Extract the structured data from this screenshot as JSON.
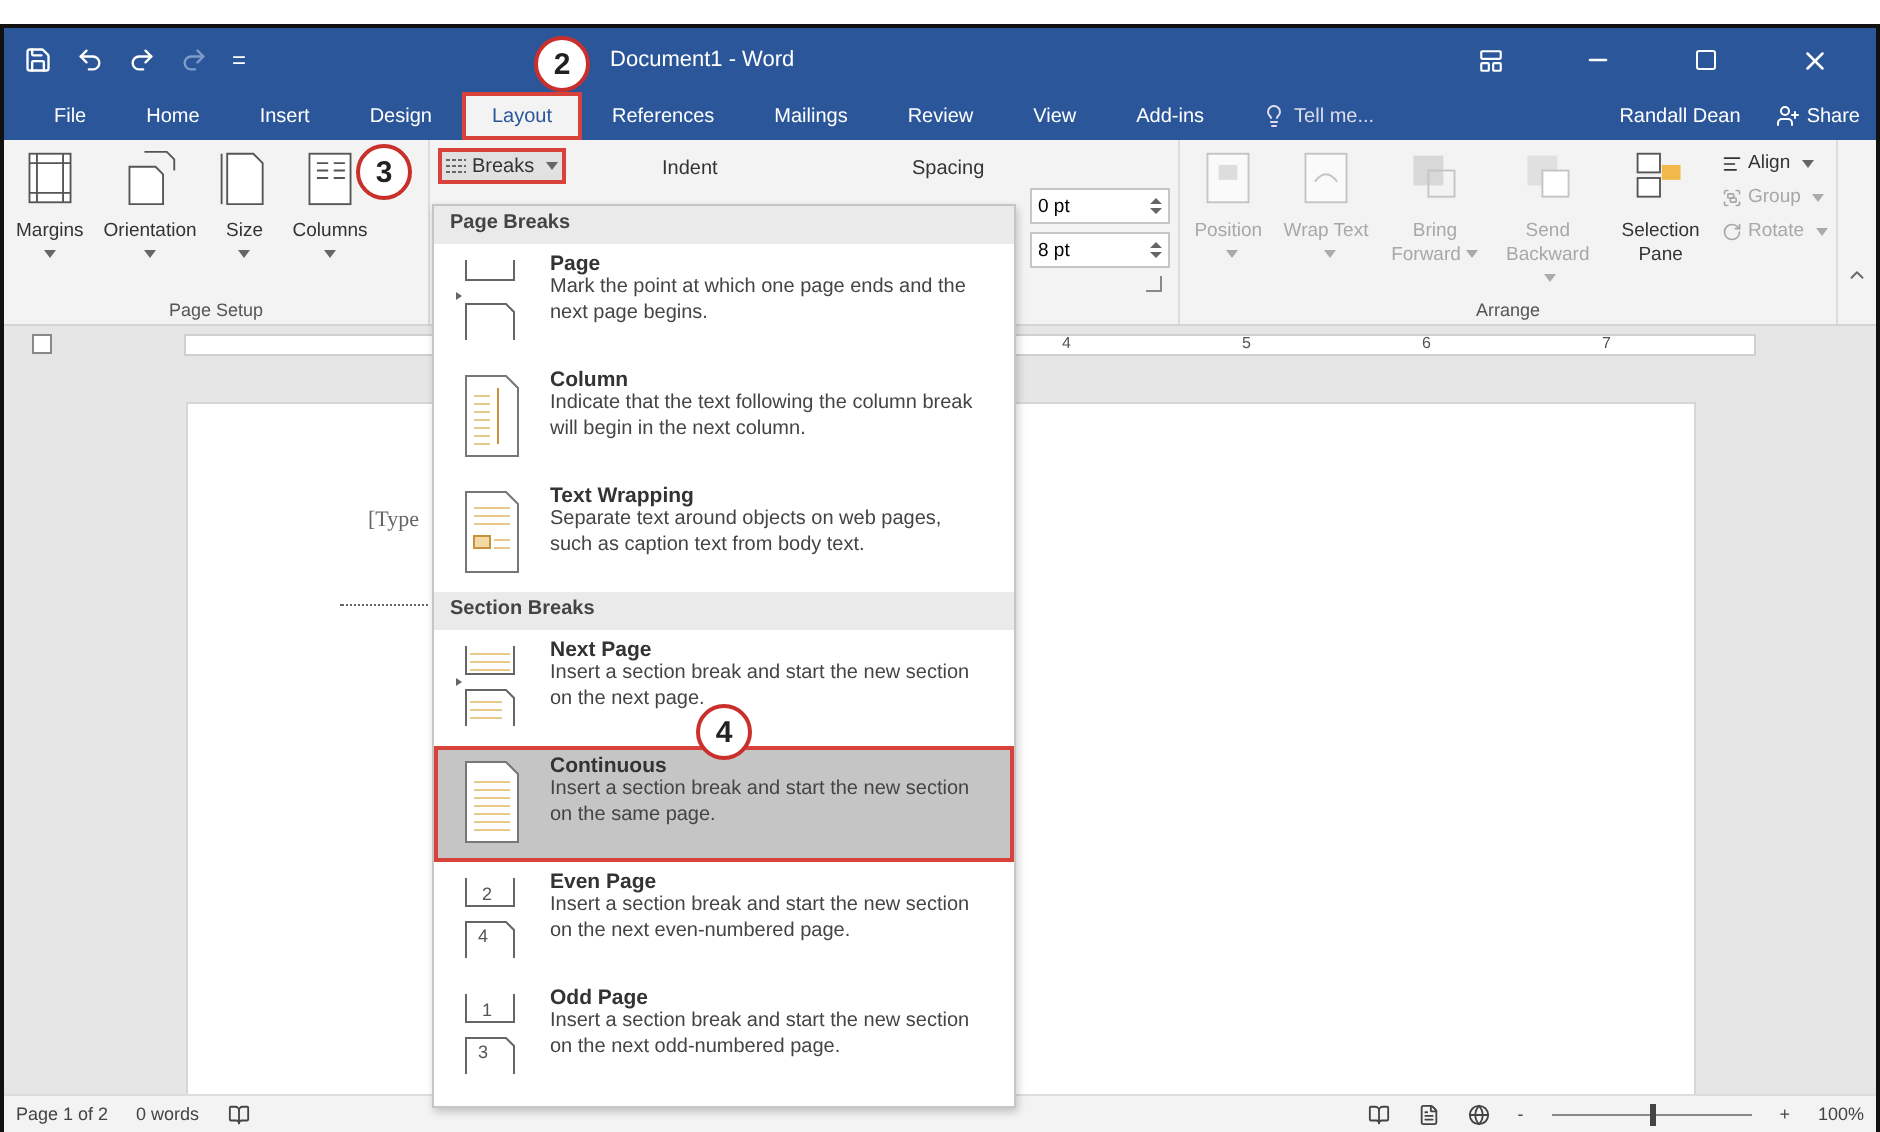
{
  "title_bar": {
    "title": "Document1 - Word",
    "customize": "="
  },
  "tabs": [
    {
      "label": "File",
      "selected": false,
      "outlined": false
    },
    {
      "label": "Home",
      "selected": false,
      "outlined": false
    },
    {
      "label": "Insert",
      "selected": false,
      "outlined": false
    },
    {
      "label": "Design",
      "selected": false,
      "outlined": false
    },
    {
      "label": "Layout",
      "selected": true,
      "outlined": true,
      "callout": "2"
    },
    {
      "label": "References",
      "selected": false,
      "outlined": false
    },
    {
      "label": "Mailings",
      "selected": false,
      "outlined": false
    },
    {
      "label": "Review",
      "selected": false,
      "outlined": false
    },
    {
      "label": "View",
      "selected": false,
      "outlined": false
    },
    {
      "label": "Add-ins",
      "selected": false,
      "outlined": false
    }
  ],
  "tell_me": "Tell me...",
  "user": "Randall Dean",
  "share": "Share",
  "ribbon": {
    "page_setup": {
      "buttons": [
        "Margins",
        "Orientation",
        "Size",
        "Columns"
      ],
      "label": "Page Setup"
    },
    "breaks": {
      "label": "Breaks",
      "outlined": true,
      "callout": "3"
    },
    "indent_label": "Indent",
    "spacing_label": "Spacing",
    "spacing_fields": [
      "0 pt",
      "8 pt"
    ],
    "arrange": {
      "buttons": [
        {
          "label": "Position",
          "disabled": true
        },
        {
          "label": "Wrap Text",
          "disabled": true
        },
        {
          "label": "Bring Forward",
          "disabled": true
        },
        {
          "label": "Send Backward",
          "disabled": true
        },
        {
          "label": "Selection Pane",
          "disabled": false
        }
      ],
      "small_buttons": [
        {
          "label": "Align",
          "disabled": false
        },
        {
          "label": "Group",
          "disabled": true
        },
        {
          "label": "Rotate",
          "disabled": true
        }
      ],
      "label": "Arrange"
    }
  },
  "ruler": {
    "numbers": [
      "4",
      "5",
      "6",
      "7"
    ]
  },
  "document": {
    "text": "[Type"
  },
  "menu": {
    "sections": [
      {
        "header": "Page Breaks",
        "items": [
          {
            "title": "Page",
            "description": "Mark the point at which one page ends and the next page begins.",
            "selected": false,
            "outlined": false
          },
          {
            "title": "Column",
            "description": "Indicate that the text following the column break will begin in the next column.",
            "selected": false,
            "outlined": false
          },
          {
            "title": "Text Wrapping",
            "description": "Separate text around objects on web pages, such as caption text from body text.",
            "selected": false,
            "outlined": false
          }
        ]
      },
      {
        "header": "Section Breaks",
        "items": [
          {
            "title": "Next Page",
            "description": "Insert a section break and start the new section on the next page.",
            "selected": false,
            "outlined": false
          },
          {
            "title": "Continuous",
            "description": "Insert a section break and start the new section on the same page.",
            "selected": true,
            "outlined": true,
            "callout": "4"
          },
          {
            "title": "Even Page",
            "description": "Insert a section break and start the new section on the next even-numbered page.",
            "selected": false,
            "outlined": false,
            "icon_numbers": [
              "2",
              "4"
            ]
          },
          {
            "title": "Odd Page",
            "description": "Insert a section break and start the new section on the next odd-numbered page.",
            "selected": false,
            "outlined": false,
            "icon_numbers": [
              "1",
              "3"
            ]
          }
        ]
      }
    ]
  },
  "status_bar": {
    "page": "Page 1 of 2",
    "words": "0 words",
    "zoom_out": "-",
    "zoom_in": "+",
    "zoom": "100%",
    "zoom_slider": {
      "level": 0.5
    }
  }
}
